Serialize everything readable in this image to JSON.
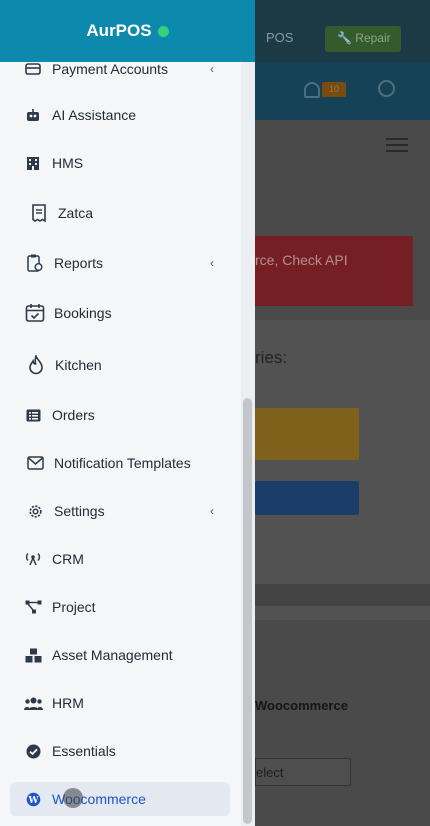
{
  "app": {
    "brand": "AurPOS"
  },
  "header": {
    "pos_label": "POS",
    "repair_label": "Repair",
    "notification_count": "10"
  },
  "background": {
    "alert_text": "rce, Check API",
    "section_heading": "ries:",
    "woo_label": "Woocommerce",
    "select_value": "elect"
  },
  "sidebar": {
    "items": [
      {
        "label": "Payment Accounts",
        "icon": "wallet-icon",
        "has_submenu": true
      },
      {
        "label": "AI Assistance",
        "icon": "robot-icon",
        "has_submenu": false
      },
      {
        "label": "HMS",
        "icon": "building-icon",
        "has_submenu": false
      },
      {
        "label": "Zatca",
        "icon": "receipt-icon",
        "has_submenu": false
      },
      {
        "label": "Reports",
        "icon": "clipboard-clock-icon",
        "has_submenu": true
      },
      {
        "label": "Bookings",
        "icon": "calendar-check-icon",
        "has_submenu": false
      },
      {
        "label": "Kitchen",
        "icon": "flame-icon",
        "has_submenu": false
      },
      {
        "label": "Orders",
        "icon": "list-icon",
        "has_submenu": false
      },
      {
        "label": "Notification Templates",
        "icon": "envelope-icon",
        "has_submenu": false
      },
      {
        "label": "Settings",
        "icon": "gear-icon",
        "has_submenu": true
      },
      {
        "label": "CRM",
        "icon": "broadcast-icon",
        "has_submenu": false
      },
      {
        "label": "Project",
        "icon": "network-icon",
        "has_submenu": false
      },
      {
        "label": "Asset Management",
        "icon": "boxes-icon",
        "has_submenu": false
      },
      {
        "label": "HRM",
        "icon": "users-icon",
        "has_submenu": false
      },
      {
        "label": "Essentials",
        "icon": "check-circle-icon",
        "has_submenu": false
      },
      {
        "label": "Woocommerce",
        "icon": "wordpress-icon",
        "has_submenu": false,
        "active": true
      }
    ]
  },
  "colors": {
    "brand": "#0c89ac",
    "active": "#1f55c9",
    "status_online": "#36d17a"
  }
}
